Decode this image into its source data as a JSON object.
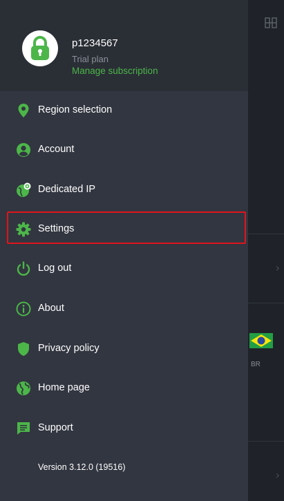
{
  "user": {
    "username": "p1234567",
    "plan": "Trial plan",
    "manage_link": "Manage subscription"
  },
  "menu": {
    "items": [
      {
        "label": "Region selection",
        "icon": "location-pin-icon"
      },
      {
        "label": "Account",
        "icon": "account-circle-icon"
      },
      {
        "label": "Dedicated IP",
        "icon": "globe-gear-icon"
      },
      {
        "label": "Settings",
        "icon": "gear-icon"
      },
      {
        "label": "Log out",
        "icon": "power-icon"
      },
      {
        "label": "About",
        "icon": "info-icon"
      },
      {
        "label": "Privacy policy",
        "icon": "shield-icon"
      },
      {
        "label": "Home page",
        "icon": "globe-icon"
      },
      {
        "label": "Support",
        "icon": "chat-bubble-icon"
      }
    ],
    "highlighted": "Settings"
  },
  "version": "Version 3.12.0 (19516)",
  "background": {
    "country_code": "BR"
  },
  "colors": {
    "accent": "#4cb649",
    "drawer_bg": "#323640",
    "header_bg": "#2a2e35",
    "highlight_border": "#e0141d"
  }
}
